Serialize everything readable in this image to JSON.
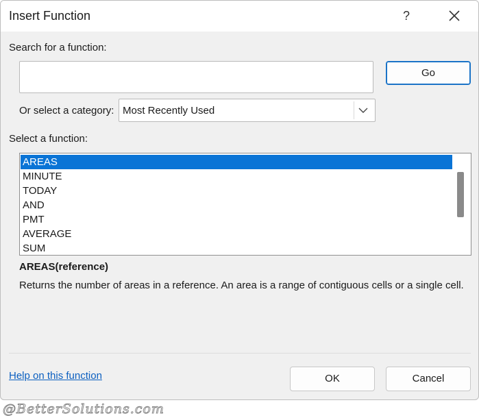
{
  "window": {
    "title": "Insert Function",
    "help_glyph": "?"
  },
  "search": {
    "label": "Search for a function:",
    "value": "",
    "placeholder": "",
    "go_label": "Go"
  },
  "category": {
    "label": "Or select a category:",
    "selected": "Most Recently Used"
  },
  "functions": {
    "label": "Select a function:",
    "items": [
      "AREAS",
      "MINUTE",
      "TODAY",
      "AND",
      "PMT",
      "AVERAGE",
      "SUM"
    ],
    "selected_index": 0
  },
  "details": {
    "signature": "AREAS(reference)",
    "description": "Returns the number of areas in a reference. An area is a range of contiguous cells or a single cell."
  },
  "footer": {
    "help_link": "Help on this function",
    "ok_label": "OK",
    "cancel_label": "Cancel"
  },
  "watermark": "@BetterSolutions.com",
  "colors": {
    "selection": "#0a74d6",
    "accent_border": "#1a73c7",
    "link": "#0b5fc0",
    "dialog_bg": "#f0f0f0"
  }
}
